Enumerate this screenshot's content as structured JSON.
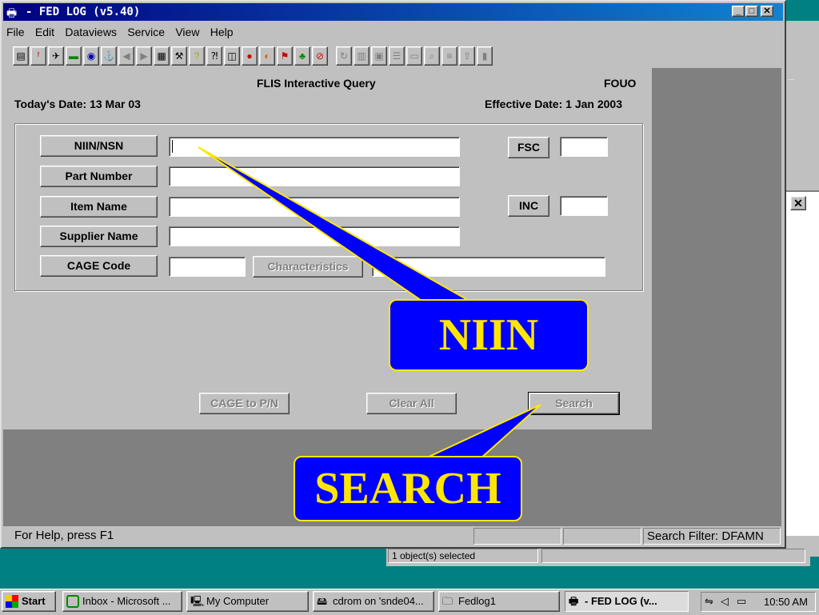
{
  "window": {
    "title": "- FED LOG (v5.40)"
  },
  "menu": [
    "File",
    "Edit",
    "Dataviews",
    "Service",
    "View",
    "Help"
  ],
  "form": {
    "heading": "FLIS Interactive Query",
    "fouo": "FOUO",
    "today": "Today's Date: 13 Mar 03",
    "effective": "Effective Date: 1 Jan 2003",
    "buttons": {
      "niin": "NIIN/NSN",
      "part": "Part Number",
      "item": "Item Name",
      "supplier": "Supplier Name",
      "cage": "CAGE Code",
      "fsc": "FSC",
      "inc": "INC",
      "characteristics": "Characteristics",
      "cage_pn": "CAGE to P/N",
      "clear": "Clear All",
      "search": "Search"
    }
  },
  "status": {
    "help": "For Help, press F1",
    "filter": "Search Filter: DFAMN"
  },
  "explorer_status": "1 object(s) selected",
  "callouts": {
    "niin": "NIIN",
    "search": "SEARCH"
  },
  "taskbar": {
    "start": "Start",
    "tasks": [
      "Inbox - Microsoft ...",
      "My Computer",
      "cdrom on 'snde04...",
      "Fedlog1",
      "- FED LOG (v..."
    ],
    "clock": "10:50 AM"
  },
  "colors": {
    "title": "#000080",
    "callout_fill": "#0000ff",
    "callout_text": "#ffe600",
    "desktop": "#008080"
  }
}
